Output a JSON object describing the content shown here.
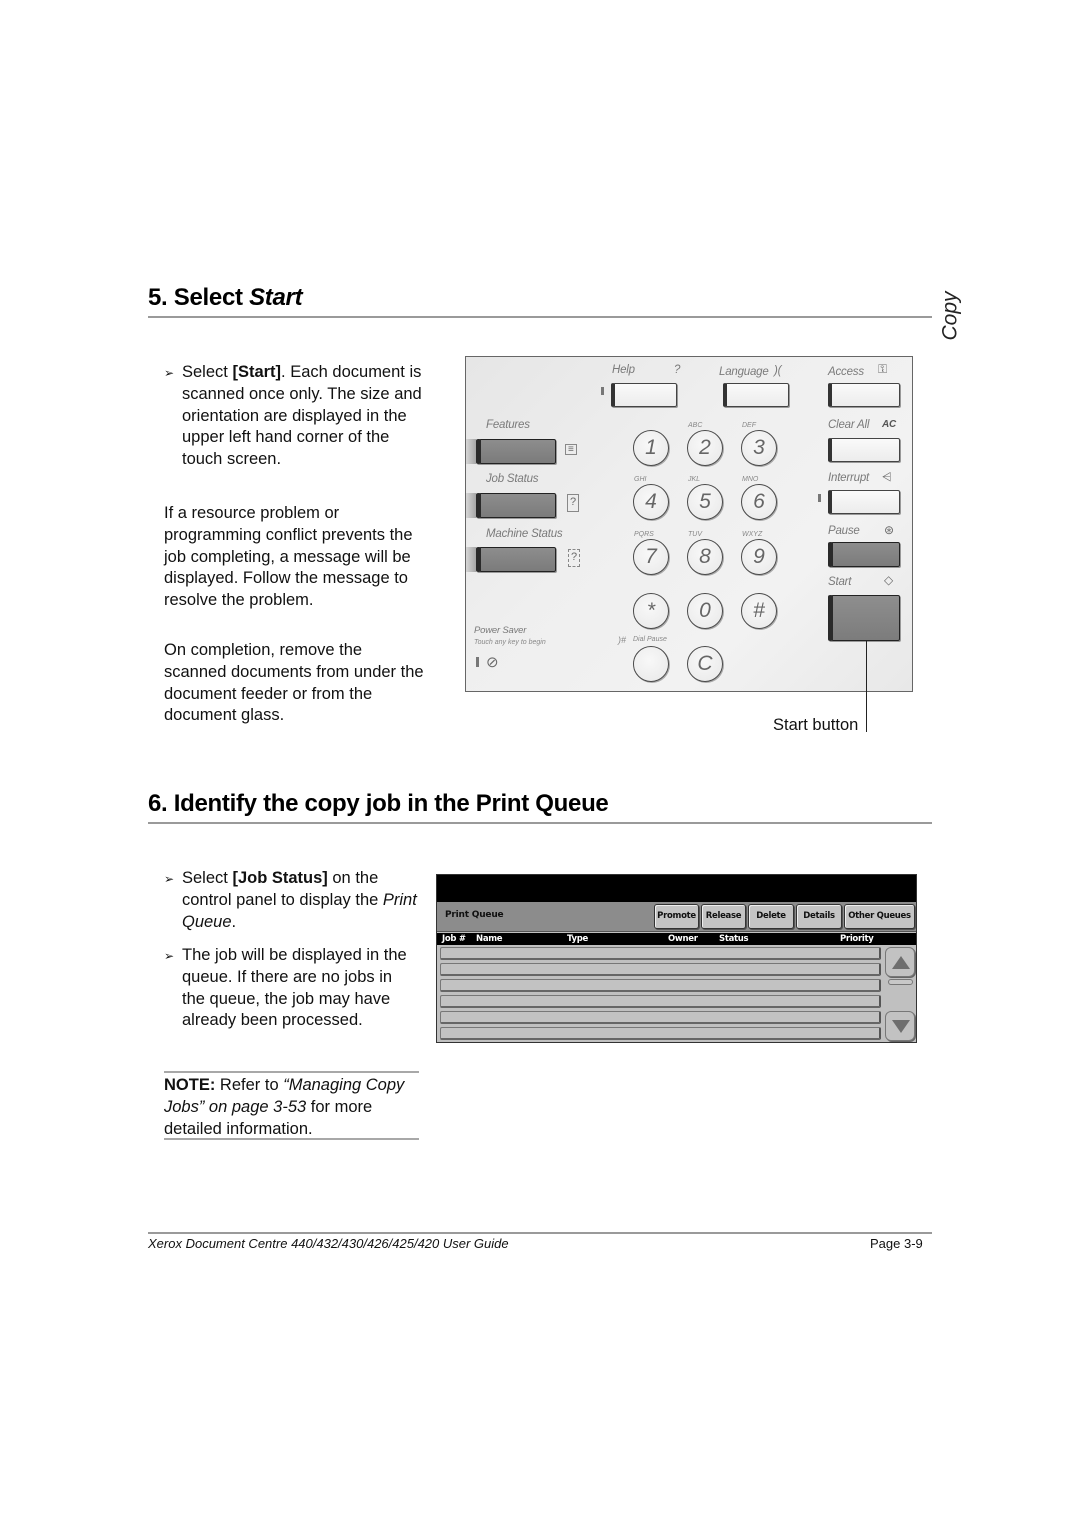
{
  "side_tab": "Copy",
  "section5": {
    "number_label": "5. Select ",
    "title_emphasis": "Start",
    "bullet": {
      "prefix": "Select ",
      "bold": "[Start]",
      "rest": ". Each document is scanned once only. The size and orientation are displayed in the upper left hand corner of the touch screen."
    },
    "paragraph1": "If a resource problem or programming conflict prevents the job completing, a message will be displayed. Follow the message to resolve the problem.",
    "paragraph2": "On completion, remove the scanned documents from under the document feeder or from the document glass.",
    "figure_callout": "Start button",
    "control_panel": {
      "help": "Help",
      "help_glyph": "?",
      "language": "Language",
      "language_glyph": ")(",
      "access": "Access",
      "access_glyph": "key-icon",
      "features": "Features",
      "job_status": "Job Status",
      "machine_status": "Machine Status",
      "clear_all": "Clear All",
      "clear_all_glyph": "AC",
      "interrupt": "Interrupt",
      "pause": "Pause",
      "start": "Start",
      "power_saver": "Power Saver",
      "power_saver_hint": "Touch any key to begin",
      "dial_pause": "Dial Pause",
      "dial_pause_glyph": ")#",
      "keys": [
        {
          "digit": "1",
          "letters": ""
        },
        {
          "digit": "2",
          "letters": "ABC"
        },
        {
          "digit": "3",
          "letters": "DEF"
        },
        {
          "digit": "4",
          "letters": "GHI"
        },
        {
          "digit": "5",
          "letters": "JKL"
        },
        {
          "digit": "6",
          "letters": "MNO"
        },
        {
          "digit": "7",
          "letters": "PQRS"
        },
        {
          "digit": "8",
          "letters": "TUV"
        },
        {
          "digit": "9",
          "letters": "WXYZ"
        },
        {
          "digit": "*",
          "letters": ""
        },
        {
          "digit": "0",
          "letters": ""
        },
        {
          "digit": "#",
          "letters": ""
        },
        {
          "digit": "",
          "letters": ""
        },
        {
          "digit": "C",
          "letters": ""
        }
      ]
    }
  },
  "section6": {
    "title": "6. Identify the copy job in the Print Queue",
    "bullet1": {
      "prefix": "Select ",
      "bold": "[Job Status]",
      "middle": " on the control panel to display the ",
      "italic": "Print Queue",
      "end": "."
    },
    "bullet2": "The job will be displayed in the queue. If there are no jobs in the queue, the job may have already been processed.",
    "note": {
      "label": "NOTE:",
      "prefix": " Refer to ",
      "italic": "“Managing Copy Jobs” on page 3-53",
      "suffix": " for more detailed information."
    },
    "print_queue": {
      "title": "Print Queue",
      "buttons": [
        "Promote",
        "Release",
        "Delete",
        "Details",
        "Other Queues"
      ],
      "columns": [
        "Job #",
        "Name",
        "Type",
        "Owner",
        "Status",
        "Priority"
      ],
      "row_count": 6
    }
  },
  "footer": {
    "guide_title": "Xerox Document Centre 440/432/430/426/425/420 User Guide",
    "page": "Page 3-9"
  }
}
